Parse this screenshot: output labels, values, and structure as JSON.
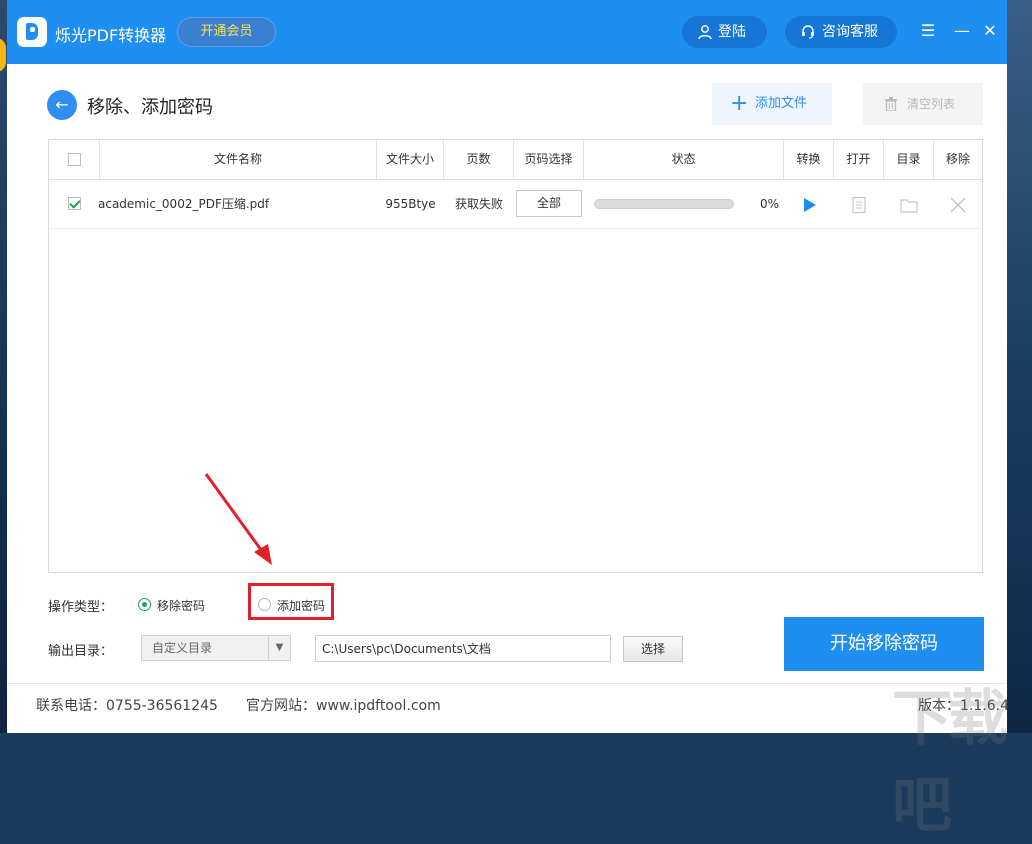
{
  "app": {
    "title": "烁光PDF转换器",
    "vip_label": "开通会员",
    "login_label": "登陆",
    "service_label": "咨询客服",
    "menu_glyph": "☰",
    "minimize_glyph": "—",
    "close_glyph": "✕",
    "brand_color": "#1f8ef1"
  },
  "header": {
    "back_glyph": "←",
    "page_title": "移除、添加密码",
    "add_file_label": "添加文件",
    "clear_list_label": "清空列表"
  },
  "table": {
    "columns": [
      "文件名称",
      "文件大小",
      "页数",
      "页码选择",
      "状态",
      "转换",
      "打开",
      "目录",
      "移除"
    ],
    "rows": [
      {
        "checked": true,
        "file_name": "academic_0002_PDF压缩.pdf",
        "file_size": "955Btye",
        "pages": "获取失败",
        "page_select": "全部",
        "progress_percent": 0,
        "progress_text": "0%"
      }
    ]
  },
  "options": {
    "op_type_label": "操作类型：",
    "remove_label": "移除密码",
    "add_label": "添加密码",
    "selected": "remove",
    "output_label": "输出目录：",
    "dir_select_value": "自定义目录",
    "path_value": "C:\\Users\\pc\\Documents\\文档",
    "choose_label": "选择",
    "start_label": "开始移除密码"
  },
  "footer": {
    "phone": "联系电话：0755-36561245",
    "website": "官方网站：www.ipdftool.com",
    "version": "版本：1.1.6.4"
  },
  "watermark_text": "下载吧"
}
